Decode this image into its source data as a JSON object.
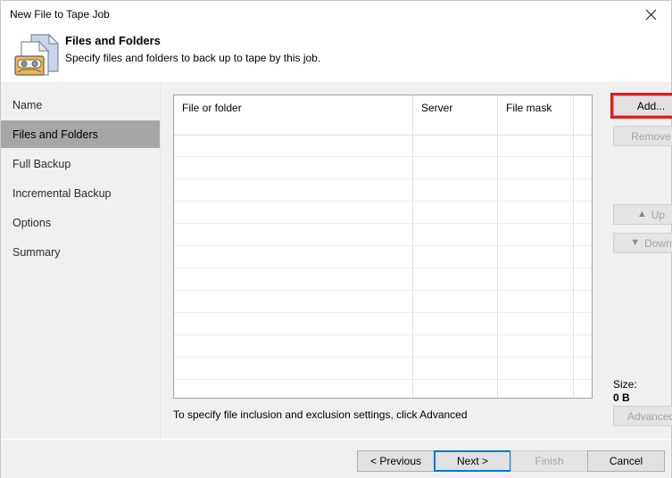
{
  "window": {
    "title": "New File to Tape Job",
    "close_icon": "close-icon"
  },
  "header": {
    "icon": "tape-files-icon",
    "title": "Files and Folders",
    "subtitle": "Specify files and folders to back up to tape by this job."
  },
  "sidebar": {
    "items": [
      {
        "label": "Name",
        "selected": false
      },
      {
        "label": "Files and Folders",
        "selected": true
      },
      {
        "label": "Full Backup",
        "selected": false
      },
      {
        "label": "Incremental Backup",
        "selected": false
      },
      {
        "label": "Options",
        "selected": false
      },
      {
        "label": "Summary",
        "selected": false
      }
    ]
  },
  "main": {
    "table": {
      "columns": [
        "File or folder",
        "Server",
        "File mask"
      ],
      "rows": []
    },
    "hint": "To specify file inclusion and exclusion settings, click Advanced",
    "size_label": "Size:",
    "size_value": "0 B",
    "buttons": {
      "add": "Add...",
      "remove": "Remove",
      "up": "Up",
      "down": "Down",
      "advanced": "Advanced"
    },
    "icons": {
      "up": "arrow-up-icon",
      "down": "arrow-down-icon"
    }
  },
  "footer": {
    "previous": "< Previous",
    "next": "Next >",
    "finish": "Finish",
    "cancel": "Cancel"
  },
  "colors": {
    "accent_focus": "#0078d7",
    "annotation_red": "#e01b1b",
    "selection_gray": "#a6a6a6",
    "window_bg": "#f0f0f0"
  }
}
